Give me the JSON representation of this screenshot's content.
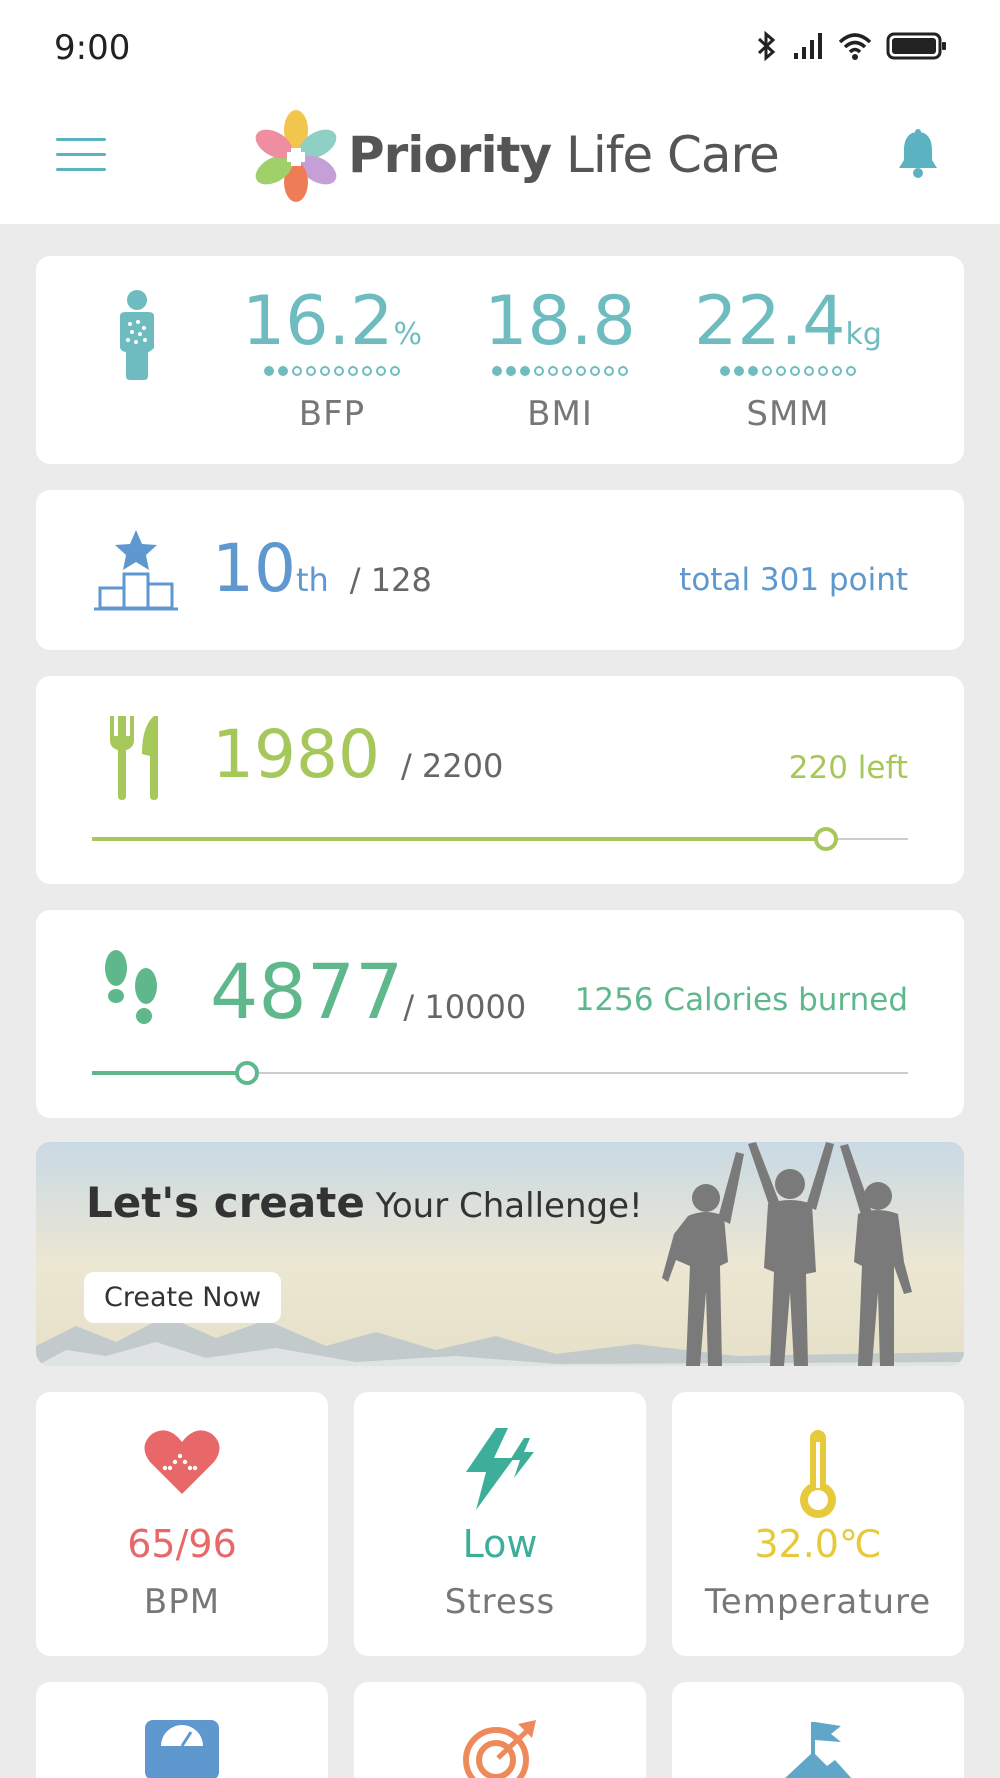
{
  "status_bar": {
    "time": "9:00"
  },
  "header": {
    "brand_bold": "Priority",
    "brand_rest": " Life Care"
  },
  "body_metrics": [
    {
      "value": "16.2",
      "unit": "%",
      "label": "BFP",
      "level": 2,
      "max": 10
    },
    {
      "value": "18.8",
      "unit": "",
      "label": "BMI",
      "level": 3,
      "max": 10
    },
    {
      "value": "22.4",
      "unit": "kg",
      "label": "SMM",
      "level": 3,
      "max": 10
    }
  ],
  "ranking": {
    "rank": "10",
    "suffix": "th",
    "total": "/ 128",
    "points": "total 301 point"
  },
  "calories": {
    "value": "1980",
    "goal": "/ 2200",
    "left": "220 left",
    "progress": 0.9,
    "color": "#a6c85a"
  },
  "steps": {
    "value": "4877",
    "goal": "/ 10000",
    "burned": "1256 Calories burned",
    "progress": 0.19,
    "color": "#5fb88c"
  },
  "banner": {
    "title_bold": "Let's create",
    "title_rest": " Your Challenge!",
    "button": "Create Now"
  },
  "tiles": [
    {
      "value": "65/96",
      "label": "BPM",
      "icon": "heart-icon",
      "color": "#e8686a"
    },
    {
      "value": "Low",
      "label": "Stress",
      "icon": "lightning-icon",
      "color": "#3dae9a"
    },
    {
      "value": "32.0℃",
      "label": "Temperature",
      "icon": "thermometer-icon",
      "color": "#e7c93c"
    }
  ],
  "tiles_row2_icons": [
    "scale-icon",
    "target-icon",
    "mountain-flag-icon"
  ]
}
